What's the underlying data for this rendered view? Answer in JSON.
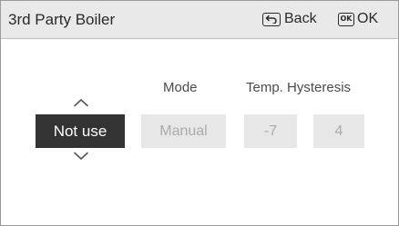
{
  "header": {
    "title": "3rd Party Boiler",
    "back_label": "Back",
    "ok_icon_text": "OK",
    "ok_label": "OK"
  },
  "columns": {
    "mode_label": "Mode",
    "temp_hysteresis_label": "Temp. Hysteresis"
  },
  "values": {
    "selected": "Not use",
    "mode": "Manual",
    "temp": "-7",
    "hysteresis": "4"
  },
  "colors": {
    "header_bg": "#e9e9e9",
    "selected_bg": "#333333",
    "disabled_bg": "#e7e7e7",
    "disabled_text": "#ababab"
  },
  "icons": {
    "back": "return-arrow-icon",
    "ok": "ok-icon",
    "up": "chevron-up-icon",
    "down": "chevron-down-icon"
  }
}
